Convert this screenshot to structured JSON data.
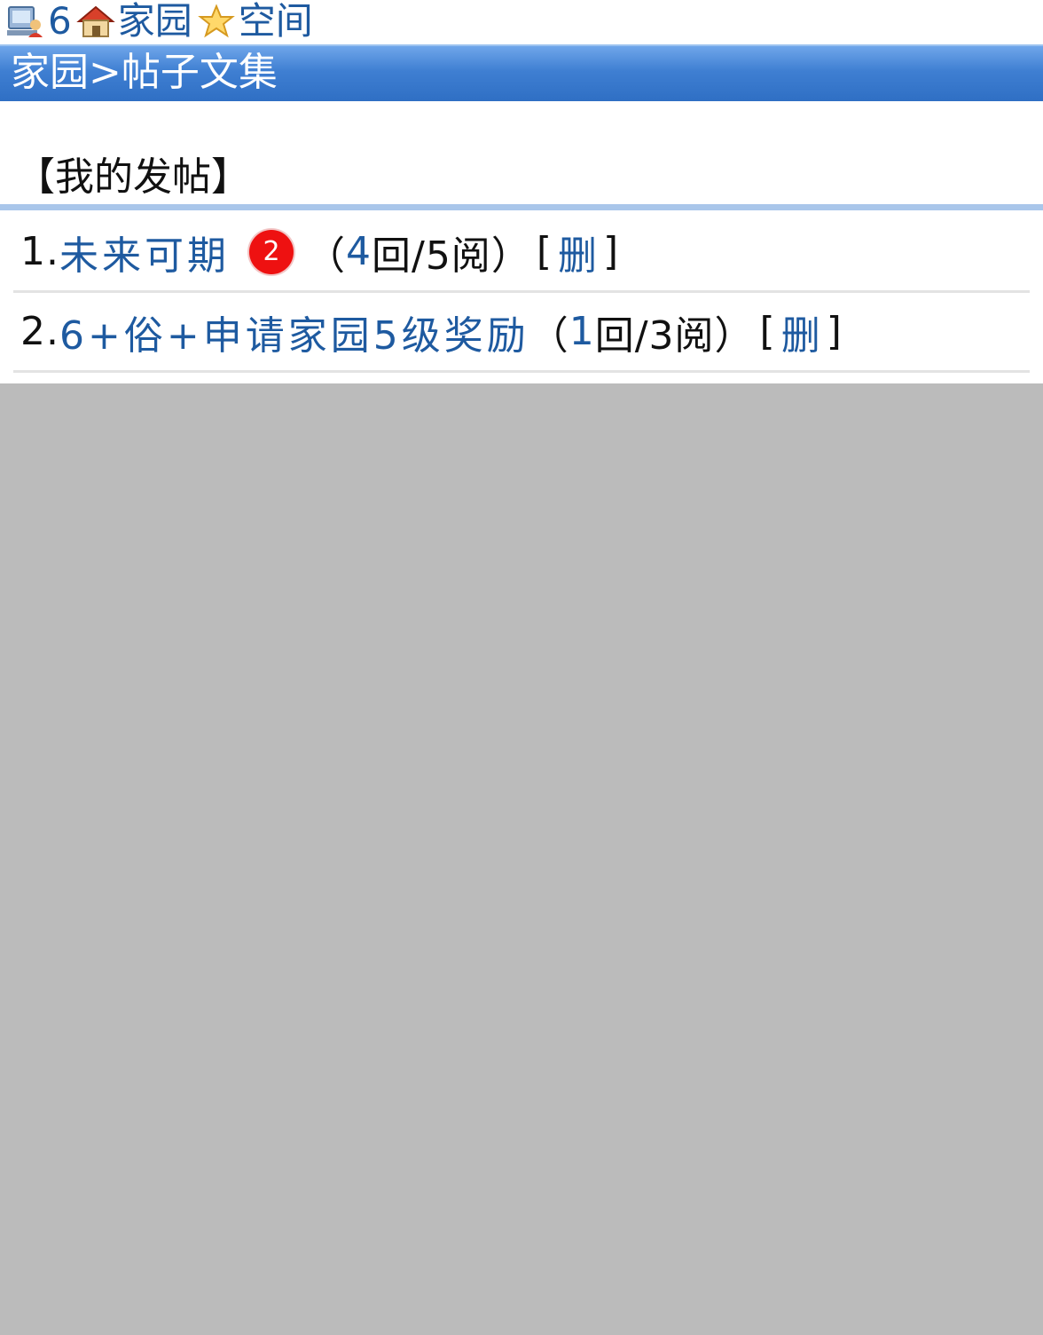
{
  "topnav": {
    "user_count": "6",
    "home_label": "家园",
    "space_label": "空间"
  },
  "titlebar": {
    "breadcrumb": "家园>帖子文集"
  },
  "section": {
    "title": "【我的发帖】"
  },
  "posts": [
    {
      "num": "1.",
      "title": "未来可期",
      "badge": "2",
      "open_paren": "（",
      "replies": "4",
      "reply_unit": "回/",
      "reads": "5阅",
      "close_paren": "）",
      "delete_label": "删"
    },
    {
      "num": "2.",
      "title": "6+俗+申请家园5级奖励",
      "badge": "",
      "open_paren": "（",
      "replies": "1",
      "reply_unit": "回/",
      "reads": "3阅",
      "close_paren": "）",
      "delete_label": "删"
    }
  ],
  "colors": {
    "link": "#1e5aa0",
    "titlebar": "#3f7fd2",
    "badge": "#ee1111",
    "overlay": "#bbbbbb"
  }
}
